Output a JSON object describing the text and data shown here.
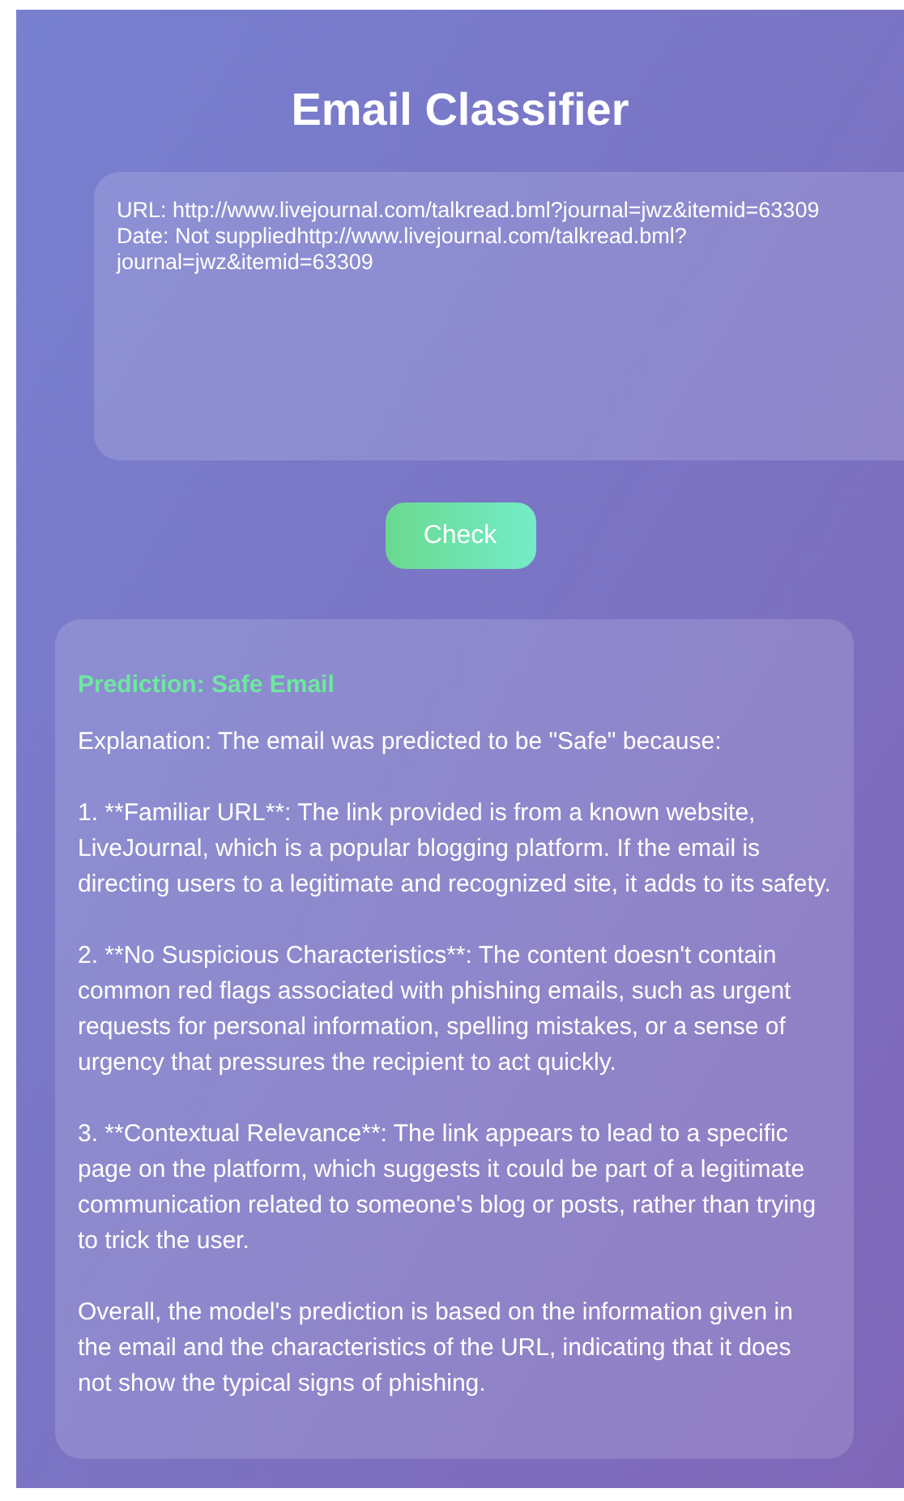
{
  "title": "Email Classifier",
  "email_input": {
    "value": "URL: http://www.livejournal.com/talkread.bml?journal=jwz&itemid=63309\nDate: Not suppliedhttp://www.livejournal.com/talkread.bml?journal=jwz&itemid=63309"
  },
  "check_button": {
    "label": "Check"
  },
  "result": {
    "prediction": "Prediction: Safe Email",
    "paragraphs": [
      "Explanation: The email was predicted to be \"Safe\" because:",
      "1. **Familiar URL**: The link provided is from a known website, LiveJournal, which is a popular blogging platform. If the email is directing users to a legitimate and recognized site, it adds to its safety.",
      "2. **No Suspicious Characteristics**: The content doesn't contain common red flags associated with phishing emails, such as urgent requests for personal information, spelling mistakes, or a sense of urgency that pressures the recipient to act quickly.",
      "3. **Contextual Relevance**: The link appears to lead to a specific page on the platform, which suggests it could be part of a legitimate communication related to someone's blog or posts, rather than trying to trick the user.",
      "Overall, the model's prediction is based on the information given in the email and the characteristics of the URL, indicating that it does not show the typical signs of phishing."
    ]
  }
}
